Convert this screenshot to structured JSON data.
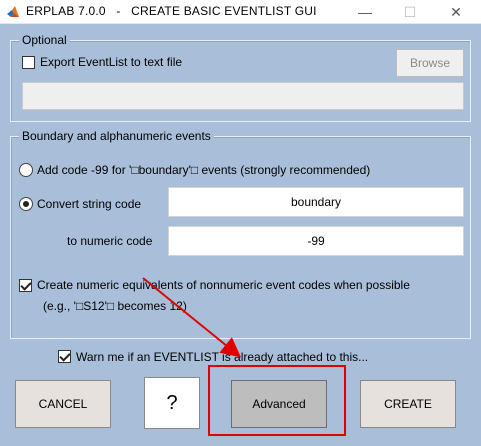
{
  "window": {
    "title": "ERPLAB 7.0.0   -   CREATE BASIC EVENTLIST GUI",
    "minimize_glyph": "—",
    "maximize_glyph": "☐",
    "close_glyph": "✕",
    "app_icon": "matlab-logo-icon"
  },
  "optional": {
    "title": "Optional",
    "export_label": "Export EventList to text file",
    "export_checked": false,
    "browse_label": "Browse",
    "path_value": ""
  },
  "boundary": {
    "title": "Boundary and alphanumeric events",
    "add_code_label": "Add code -99 for '□boundary'□ events (strongly recommended)",
    "add_code_selected": false,
    "convert_label": "Convert string code",
    "convert_selected": true,
    "string_code_value": "boundary",
    "to_numeric_label": "to numeric code",
    "numeric_code_value": "-99",
    "create_numeric_label": "Create numeric equivalents of nonnumeric event codes when possible",
    "create_numeric_example": "(e.g., '□S12'□ becomes 12)",
    "create_numeric_checked": true
  },
  "warn": {
    "label": "Warn me if an EVENTLIST is already attached to this...",
    "checked": true
  },
  "buttons": {
    "cancel": "CANCEL",
    "help": "?",
    "advanced": "Advanced",
    "create": "CREATE"
  },
  "annotation": {
    "color": "#e00000"
  }
}
